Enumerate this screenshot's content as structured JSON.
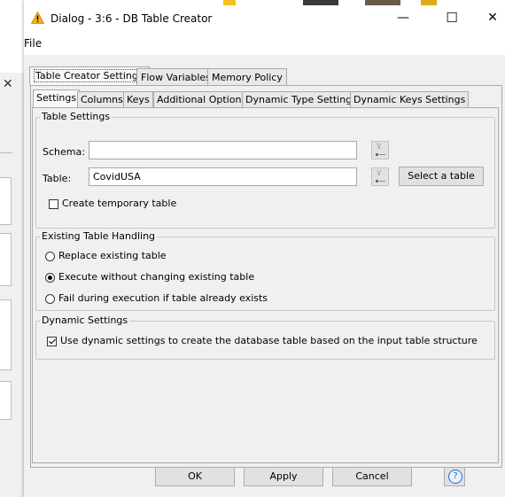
{
  "window": {
    "title": "Dialog - 3:6 - DB Table Creator",
    "minimize_glyph": "—",
    "maximize_glyph": "☐",
    "close_glyph": "✕",
    "icon": "warning-triangle-icon",
    "accent_color": "#f2b01e"
  },
  "menu": {
    "file_label": "File"
  },
  "background_window": {
    "close_glyph": "✕"
  },
  "outer_tabs": [
    {
      "label": "Table Creator Settings",
      "selected": true
    },
    {
      "label": "Flow Variables",
      "selected": false
    },
    {
      "label": "Memory Policy",
      "selected": false
    }
  ],
  "inner_tabs": [
    {
      "label": "Settings",
      "selected": true
    },
    {
      "label": "Columns",
      "selected": false
    },
    {
      "label": "Keys",
      "selected": false
    },
    {
      "label": "Additional Options",
      "selected": false
    },
    {
      "label": "Dynamic Type Settings",
      "selected": false
    },
    {
      "label": "Dynamic Keys Settings",
      "selected": false
    }
  ],
  "table_settings": {
    "legend": "Table Settings",
    "schema_label": "Schema:",
    "schema_value": "",
    "table_label": "Table:",
    "table_value": "CovidUSA",
    "select_table_label": "Select a table",
    "temporary_label": "Create temporary table",
    "temporary_checked": false,
    "flow_variable_icon": "flow-variable-icon"
  },
  "existing_table_handling": {
    "legend": "Existing Table Handling",
    "options": [
      {
        "label": "Replace existing table",
        "selected": false
      },
      {
        "label": "Execute without changing existing table",
        "selected": true
      },
      {
        "label": "Fail during execution if table already exists",
        "selected": false
      }
    ]
  },
  "dynamic_settings": {
    "legend": "Dynamic Settings",
    "checkbox_label": "Use dynamic settings to create the database table based on the input table structure",
    "checked": true
  },
  "buttons": {
    "ok": "OK",
    "apply": "Apply",
    "cancel": "Cancel",
    "help_glyph": "?"
  }
}
